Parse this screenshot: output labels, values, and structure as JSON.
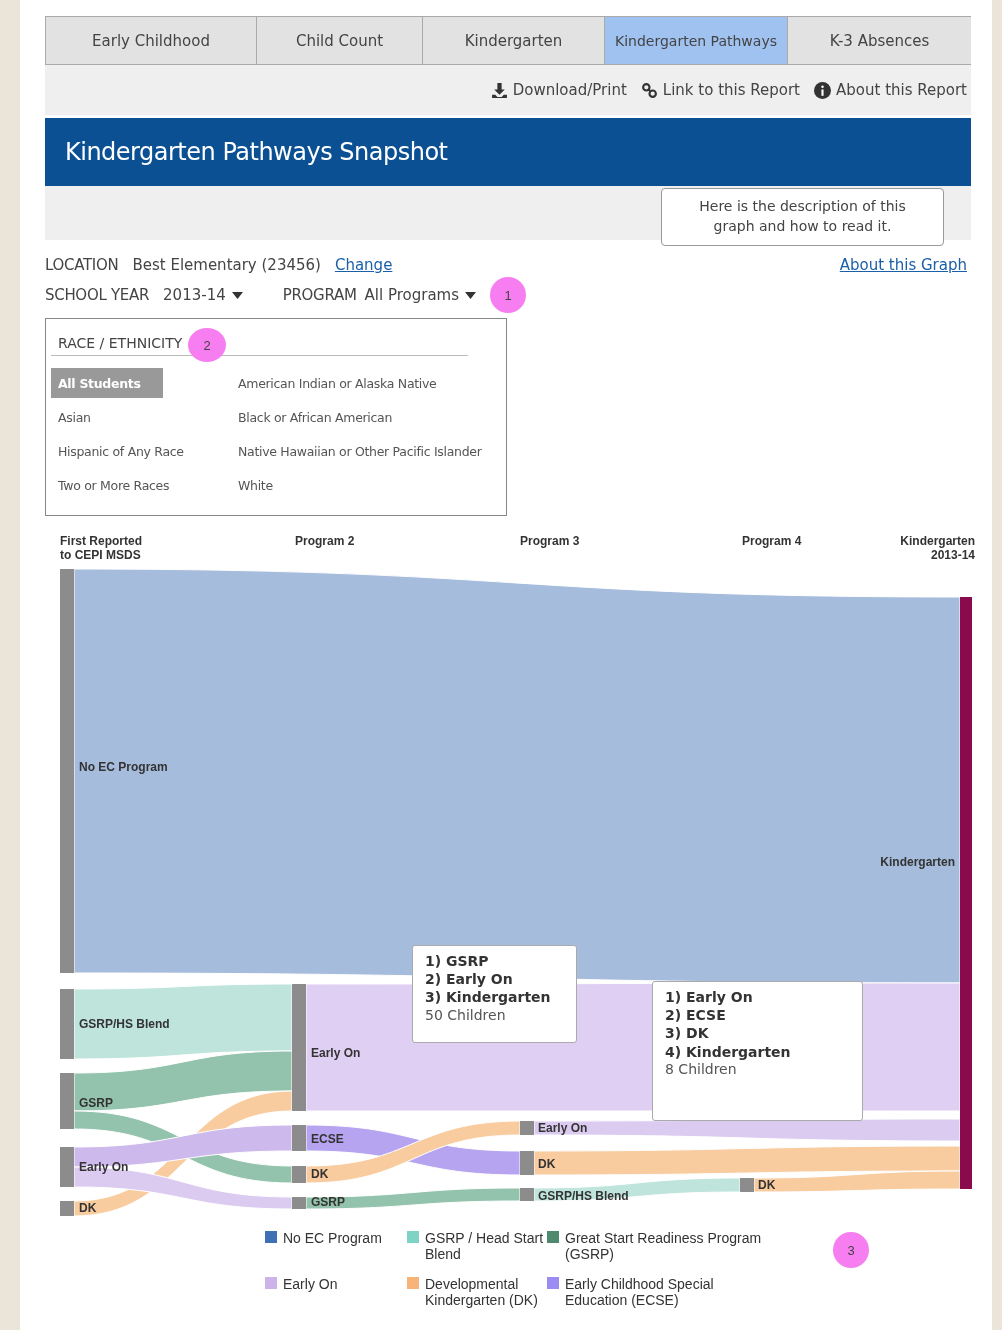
{
  "tabs": [
    {
      "label": "Early Childhood",
      "selected": false
    },
    {
      "label": "Child Count",
      "selected": false
    },
    {
      "label": "Kindergarten",
      "selected": false
    },
    {
      "label": "Kindergarten Pathways",
      "selected": true
    },
    {
      "label": "K-3 Absences",
      "selected": false
    }
  ],
  "toolbar": [
    {
      "label": "Download/Print",
      "kind": "download"
    },
    {
      "label": "Link to this Report",
      "kind": "link"
    },
    {
      "label": "About this Report",
      "kind": "info"
    }
  ],
  "title": "Kindergarten Pathways Snapshot",
  "description_callout": "Here is the description of this graph and how to read it.",
  "about_link": "About this Graph",
  "filters": {
    "location_label": "LOCATION",
    "location_value": "Best Elementary (23456)",
    "change_link": "Change",
    "school_year_label": "SCHOOL YEAR",
    "school_year_value": "2013-14",
    "program_label": "PROGRAM",
    "program_value": "All Programs",
    "badge": "1"
  },
  "race_ethnicity": {
    "heading": "RACE / ETHNICITY",
    "badge": "2",
    "options": [
      {
        "label": "All Students",
        "selected": true
      },
      {
        "label": "American Indian or Alaska Native",
        "selected": false
      },
      {
        "label": "Asian",
        "selected": false
      },
      {
        "label": "Black or African American",
        "selected": false
      },
      {
        "label": "Hispanic of Any Race",
        "selected": false
      },
      {
        "label": "Native Hawaiian or Other Pacific Islander",
        "selected": false
      },
      {
        "label": "Two or More Races",
        "selected": false
      },
      {
        "label": "White",
        "selected": false
      }
    ]
  },
  "sankey": {
    "columns": [
      "First Reported\nto CEPI MSDS",
      "Program 2",
      "Program 3",
      "Program 4",
      "Kindergarten\n2013-14"
    ],
    "nodes": [
      {
        "label": "No EC Program"
      },
      {
        "label": "GSRP/HS Blend"
      },
      {
        "label": "GSRP"
      },
      {
        "label": "Early On"
      },
      {
        "label": "DK"
      },
      {
        "label": "Early On"
      },
      {
        "label": "ECSE"
      },
      {
        "label": "DK"
      },
      {
        "label": "GSRP"
      },
      {
        "label": "Early On"
      },
      {
        "label": "DK"
      },
      {
        "label": "GSRP/HS Blend"
      },
      {
        "label": "DK"
      },
      {
        "label": "Kindergarten"
      }
    ],
    "tooltips": [
      {
        "steps": [
          "1) GSRP",
          "2) Early On",
          "3) Kindergarten"
        ],
        "count": "50 Children"
      },
      {
        "steps": [
          "1) Early On",
          "2) ECSE",
          "3) DK",
          "4) Kindergarten"
        ],
        "count": "8 Children"
      }
    ]
  },
  "legend": {
    "items": [
      {
        "label": "No EC Program",
        "color": "#3f6fb5"
      },
      {
        "label": "GSRP / Head Start Blend",
        "color": "#7fd3c4"
      },
      {
        "label": "Great Start Readiness Program (GSRP)",
        "color": "#4f8a6e"
      },
      {
        "label": "Early On",
        "color": "#cdb3ea"
      },
      {
        "label": "Developmental Kindergarten (DK)",
        "color": "#f8b478"
      },
      {
        "label": "Early Childhood Special Education (ECSE)",
        "color": "#9a8cf2"
      }
    ],
    "badge": "3"
  }
}
